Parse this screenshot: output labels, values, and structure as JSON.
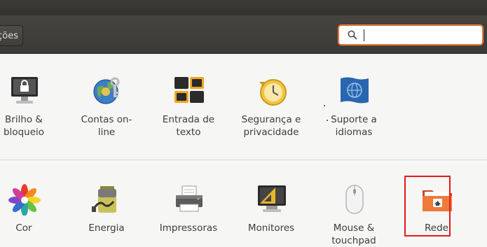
{
  "toolbar": {
    "back_label": "ções",
    "search": {
      "value": "",
      "placeholder": ""
    }
  },
  "personal_row": [
    {
      "label": "Brilho &\nbloqueio",
      "icon": "monitor-lock-icon"
    },
    {
      "label": "Contas on-\nline",
      "icon": "globe-key-icon"
    },
    {
      "label": "Entrada de\ntexto",
      "icon": "keyboard-keys-icon"
    },
    {
      "label": "Segurança e\nprivacidade",
      "icon": "clock-history-icon"
    },
    {
      "label": "Suporte a\nidiomas",
      "icon": "language-flag-icon"
    }
  ],
  "hardware_row": [
    {
      "label": "Cor",
      "icon": "color-star-icon"
    },
    {
      "label": "Energia",
      "icon": "battery-icon"
    },
    {
      "label": "Impressoras",
      "icon": "printer-icon"
    },
    {
      "label": "Monitores",
      "icon": "monitor-ruler-icon"
    },
    {
      "label": "Mouse &\ntouchpad",
      "icon": "mouse-icon"
    },
    {
      "label": "Rede",
      "icon": "network-folder-icon"
    }
  ],
  "colors": {
    "accent": "#e2651c",
    "highlight": "#e41a1a",
    "toolbar": "#3c3b37"
  }
}
